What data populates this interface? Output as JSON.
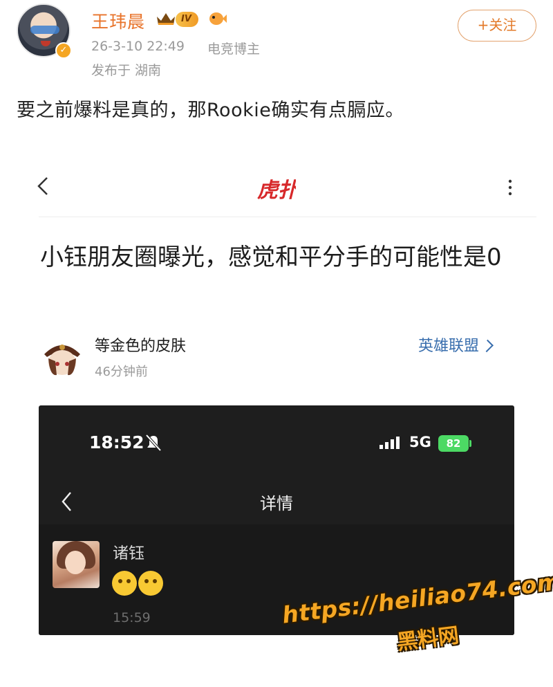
{
  "post": {
    "author_name": "王玮晨",
    "level_badge": "IV",
    "time": "26-3-10 22:49",
    "role": "电竞博主",
    "location": "发布于 湖南",
    "follow_label": "+关注",
    "text": "要之前爆料是真的，那Rookie确实有点膈应。"
  },
  "embed": {
    "logo": "虎扑",
    "article_title": "小钰朋友圈曝光，感觉和平分手的可能性是0",
    "poster_name": "等金色的皮肤",
    "poster_time": "46分钟前",
    "board_label": "英雄联盟"
  },
  "phone": {
    "time": "18:52",
    "network": "5G",
    "battery": "82",
    "nav_title": "详情",
    "friend_name": "诸钰",
    "moment_time": "15:59"
  },
  "watermark": {
    "url": "https://heiliao74.com",
    "name": "黑料网"
  },
  "colors": {
    "author_name": "#e8732a",
    "follow_border": "#e3a36f",
    "link_blue": "#3a6fae",
    "phone_bg": "#1e1e1e",
    "battery_green": "#4cd964",
    "watermark": "#f5a623"
  },
  "icons": [
    "crown-icon",
    "fish-icon",
    "verified-icon",
    "back-icon",
    "more-icon",
    "chevron-right-icon",
    "mute-icon",
    "signal-icon",
    "emoji-thinking-icon"
  ]
}
